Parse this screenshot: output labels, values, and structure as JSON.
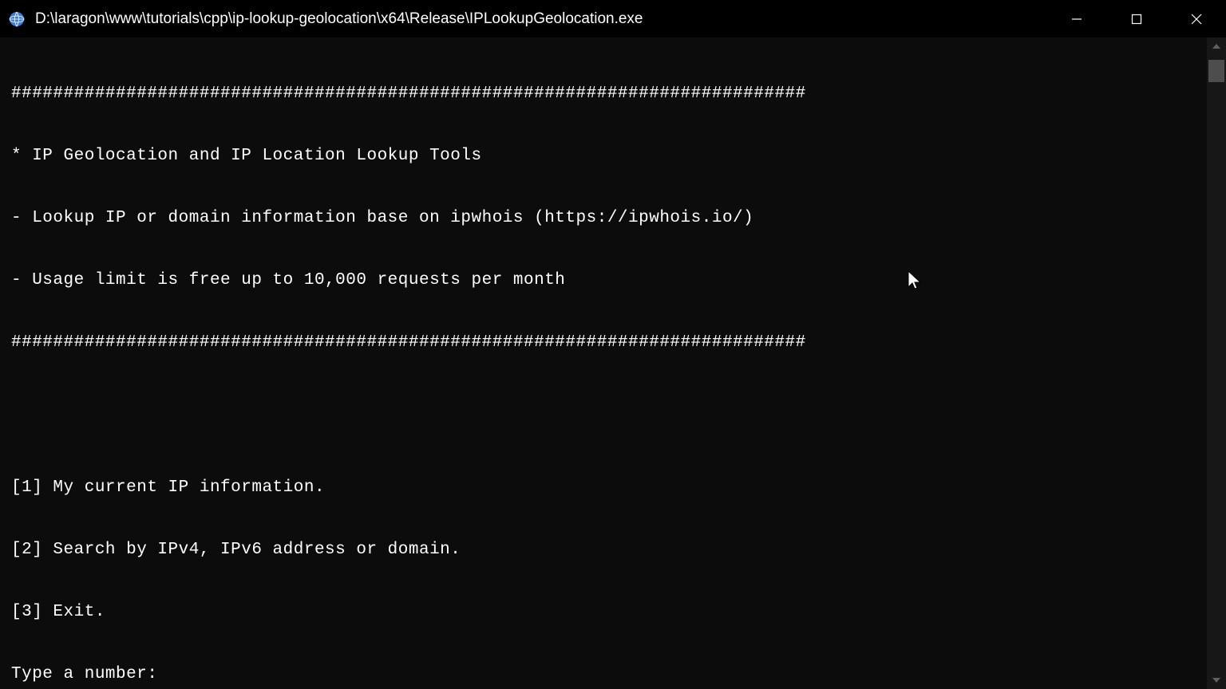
{
  "titlebar": {
    "title": "D:\\laragon\\www\\tutorials\\cpp\\ip-lookup-geolocation\\x64\\Release\\IPLookupGeolocation.exe"
  },
  "console": {
    "lines": [
      "############################################################################",
      "* IP Geolocation and IP Location Lookup Tools",
      "- Lookup IP or domain information base on ipwhois (https://ipwhois.io/)",
      "- Usage limit is free up to 10,000 requests per month",
      "############################################################################",
      "",
      "",
      "[1] My current IP information.",
      "[2] Search by IPv4, IPv6 address or domain.",
      "[3] Exit.",
      "Type a number:"
    ]
  }
}
